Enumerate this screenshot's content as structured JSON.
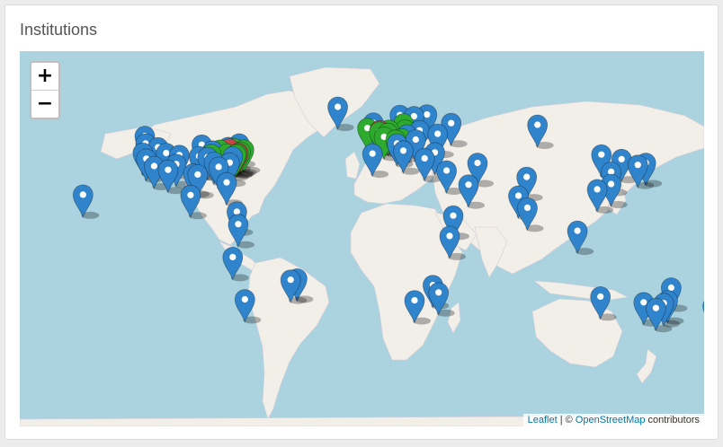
{
  "card": {
    "title": "Institutions"
  },
  "map": {
    "zoom_in_label": "+",
    "zoom_out_label": "−",
    "attribution": {
      "leaflet_link": "Leaflet",
      "separator": " | © ",
      "osm_link": "OpenStreetMap",
      "suffix": " contributors"
    }
  },
  "colors": {
    "ocean": "#aad3df",
    "land": "#f2efe9",
    "marker_blue": "#2f84cc",
    "marker_green": "#2eaa2e",
    "marker_red": "#c8464a"
  },
  "markers": [
    {
      "color": "blue",
      "lat": 19.6,
      "lon": -155.5
    },
    {
      "color": "blue",
      "lat": 49.3,
      "lon": -123.1
    },
    {
      "color": "blue",
      "lat": 45.5,
      "lon": -122.7
    },
    {
      "color": "blue",
      "lat": 43.6,
      "lon": -116.2
    },
    {
      "color": "blue",
      "lat": 40.8,
      "lon": -124.1
    },
    {
      "color": "blue",
      "lat": 37.8,
      "lon": -122.3
    },
    {
      "color": "blue",
      "lat": 34.1,
      "lon": -118.2
    },
    {
      "color": "blue",
      "lat": 40.7,
      "lon": -111.9
    },
    {
      "color": "blue",
      "lat": 39.7,
      "lon": -105.0
    },
    {
      "color": "blue",
      "lat": 35.1,
      "lon": -106.6
    },
    {
      "color": "blue",
      "lat": 32.2,
      "lon": -110.9
    },
    {
      "color": "blue",
      "lat": 44.9,
      "lon": -93.2
    },
    {
      "color": "blue",
      "lat": 41.9,
      "lon": -87.6
    },
    {
      "color": "blue",
      "lat": 39.1,
      "lon": -94.6
    },
    {
      "color": "blue",
      "lat": 38.6,
      "lon": -90.2
    },
    {
      "color": "blue",
      "lat": 36.2,
      "lon": -86.8
    },
    {
      "color": "blue",
      "lat": 33.7,
      "lon": -84.4
    },
    {
      "color": "blue",
      "lat": 30.3,
      "lon": -97.7
    },
    {
      "color": "blue",
      "lat": 29.8,
      "lon": -95.4
    },
    {
      "color": "blue",
      "lat": 43.7,
      "lon": -79.4
    },
    {
      "color": "blue",
      "lat": 45.5,
      "lon": -73.6
    },
    {
      "color": "blue",
      "lat": 35.8,
      "lon": -78.6
    },
    {
      "color": "blue",
      "lat": 38.9,
      "lon": -77.0
    },
    {
      "color": "green",
      "lat": 42.3,
      "lon": -83.7
    },
    {
      "color": "green",
      "lat": 40.4,
      "lon": -80.0
    },
    {
      "color": "green",
      "lat": 42.4,
      "lon": -71.1
    },
    {
      "color": "green",
      "lat": 41.3,
      "lon": -72.9
    },
    {
      "color": "green",
      "lat": 40.4,
      "lon": -74.7
    },
    {
      "color": "green",
      "lat": 39.9,
      "lon": -75.2
    },
    {
      "color": "green",
      "lat": 43.1,
      "lon": -76.1
    },
    {
      "color": "green",
      "lat": 40.1,
      "lon": -88.2
    },
    {
      "color": "red",
      "lat": 40.7,
      "lon": -74.0
    },
    {
      "color": "red",
      "lat": 42.9,
      "lon": -78.9
    },
    {
      "color": "blue",
      "lat": 25.8,
      "lon": -80.2
    },
    {
      "color": "blue",
      "lat": 19.4,
      "lon": -99.1
    },
    {
      "color": "blue",
      "lat": 11.0,
      "lon": -74.8
    },
    {
      "color": "blue",
      "lat": 4.7,
      "lon": -74.1
    },
    {
      "color": "blue",
      "lat": -12.0,
      "lon": -77.0
    },
    {
      "color": "blue",
      "lat": -22.9,
      "lon": -43.2
    },
    {
      "color": "blue",
      "lat": -23.5,
      "lon": -46.6
    },
    {
      "color": "blue",
      "lat": -33.4,
      "lon": -70.6
    },
    {
      "color": "blue",
      "lat": 64.1,
      "lon": -21.9
    },
    {
      "color": "blue",
      "lat": 59.9,
      "lon": 10.7
    },
    {
      "color": "blue",
      "lat": 59.3,
      "lon": 18.1
    },
    {
      "color": "blue",
      "lat": 60.2,
      "lon": 24.9
    },
    {
      "color": "blue",
      "lat": 55.8,
      "lon": 37.6
    },
    {
      "color": "blue",
      "lat": 56.0,
      "lon": -3.2
    },
    {
      "color": "green",
      "lat": 55.7,
      "lon": 12.6
    },
    {
      "color": "green",
      "lat": 51.5,
      "lon": -0.1
    },
    {
      "color": "green",
      "lat": 52.4,
      "lon": 4.9
    },
    {
      "color": "green",
      "lat": 52.5,
      "lon": 13.4
    },
    {
      "color": "green",
      "lat": 48.9,
      "lon": 2.4
    },
    {
      "color": "green",
      "lat": 48.1,
      "lon": 11.6
    },
    {
      "color": "green",
      "lat": 50.8,
      "lon": 4.4
    },
    {
      "color": "green",
      "lat": 47.4,
      "lon": 8.5
    },
    {
      "color": "green",
      "lat": 53.3,
      "lon": -6.3
    },
    {
      "color": "red",
      "lat": 52.2,
      "lon": 0.1
    },
    {
      "color": "blue",
      "lat": 45.5,
      "lon": 9.2
    },
    {
      "color": "blue",
      "lat": 40.4,
      "lon": -3.7
    },
    {
      "color": "blue",
      "lat": 41.9,
      "lon": 12.5
    },
    {
      "color": "blue",
      "lat": 50.1,
      "lon": 14.4
    },
    {
      "color": "blue",
      "lat": 47.5,
      "lon": 19.0
    },
    {
      "color": "blue",
      "lat": 52.2,
      "lon": 21.0
    },
    {
      "color": "blue",
      "lat": 38.0,
      "lon": 23.7
    },
    {
      "color": "blue",
      "lat": 50.4,
      "lon": 30.5
    },
    {
      "color": "blue",
      "lat": 55.0,
      "lon": 82.9
    },
    {
      "color": "blue",
      "lat": 41.0,
      "lon": 29.0
    },
    {
      "color": "blue",
      "lat": 31.8,
      "lon": 35.2
    },
    {
      "color": "blue",
      "lat": 35.7,
      "lon": 51.4
    },
    {
      "color": "blue",
      "lat": 24.7,
      "lon": 46.7
    },
    {
      "color": "blue",
      "lat": 9.0,
      "lon": 38.7
    },
    {
      "color": "blue",
      "lat": -1.3,
      "lon": 36.8
    },
    {
      "color": "blue",
      "lat": 28.6,
      "lon": 77.2
    },
    {
      "color": "blue",
      "lat": 19.1,
      "lon": 72.9
    },
    {
      "color": "blue",
      "lat": 13.0,
      "lon": 77.6
    },
    {
      "color": "blue",
      "lat": 39.9,
      "lon": 116.4
    },
    {
      "color": "blue",
      "lat": 37.6,
      "lon": 127.0
    },
    {
      "color": "blue",
      "lat": 35.7,
      "lon": 139.7
    },
    {
      "color": "blue",
      "lat": 34.7,
      "lon": 135.5
    },
    {
      "color": "blue",
      "lat": 31.2,
      "lon": 121.5
    },
    {
      "color": "blue",
      "lat": 25.0,
      "lon": 121.5
    },
    {
      "color": "blue",
      "lat": 22.3,
      "lon": 114.2
    },
    {
      "color": "blue",
      "lat": 1.3,
      "lon": 103.8
    },
    {
      "color": "blue",
      "lat": -26.2,
      "lon": 28.0
    },
    {
      "color": "blue",
      "lat": -29.9,
      "lon": 31.0
    },
    {
      "color": "blue",
      "lat": -33.9,
      "lon": 18.4
    },
    {
      "color": "blue",
      "lat": -32.0,
      "lon": 115.9
    },
    {
      "color": "blue",
      "lat": -27.5,
      "lon": 153.0
    },
    {
      "color": "blue",
      "lat": -33.9,
      "lon": 151.2
    },
    {
      "color": "blue",
      "lat": -35.3,
      "lon": 149.1
    },
    {
      "color": "blue",
      "lat": -37.8,
      "lon": 145.0
    },
    {
      "color": "blue",
      "lat": -34.9,
      "lon": 138.6
    },
    {
      "color": "blue",
      "lat": -36.8,
      "lon": 174.8
    }
  ]
}
